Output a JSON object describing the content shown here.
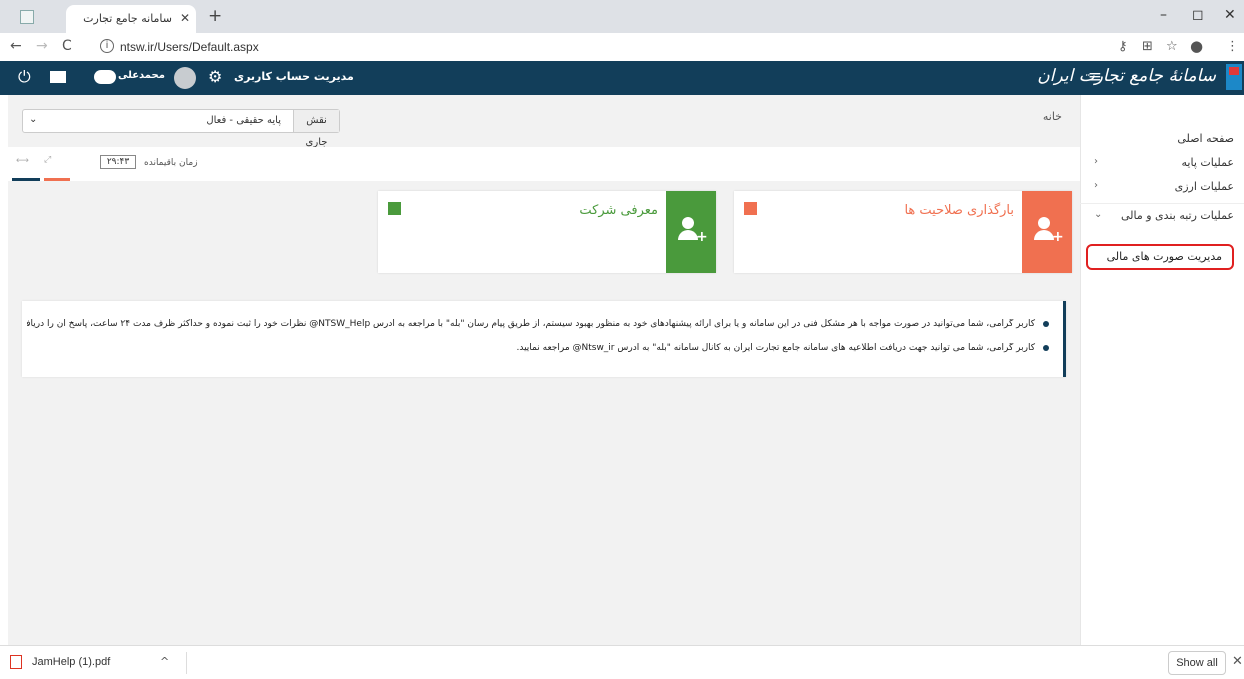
{
  "browser": {
    "tab_title": "سامانه جامع تجارت",
    "tab_close": "✕",
    "new_tab": "+",
    "url": "ntsw.ir/Users/Default.aspx",
    "back": "←",
    "forward": "→",
    "reload": "C",
    "info": "i",
    "minimize": "–",
    "maximize": "◻",
    "close": "✕",
    "key_icon": "⚷",
    "translate_icon": "⊞",
    "star_icon": "☆",
    "profile_icon": "●",
    "menu_icon": "⋮"
  },
  "header": {
    "brand": "سامانهٔ جامع تجارت ایران",
    "hamburger": "≡",
    "account_settings": "مدیریت حساب کاربری",
    "gear": "⚙",
    "username": "محمدعلی",
    "power": "⏻",
    "colors": {
      "bar": "#123e5a"
    }
  },
  "sidebar": {
    "items": [
      {
        "label": "صفحه اصلی",
        "icon": "🏠",
        "arrow": ""
      },
      {
        "label": "عملیات پایه",
        "icon": "📊",
        "arrow": "‹"
      },
      {
        "label": "عملیات ارزی",
        "icon": "👥",
        "arrow": "‹"
      },
      {
        "label": "عملیات رتبه بندی و مالی",
        "icon": "📊",
        "arrow": "⌄"
      }
    ],
    "submenu_item": "مدیریت صورت های مالی"
  },
  "main": {
    "breadcrumb": "خانه",
    "home_icon": "🏠",
    "role_label": "نقش جاری",
    "role_value": "پایه حقیقی - فعال",
    "role_caret": "⌄",
    "time_label": "زمان باقیمانده",
    "time_value": "۲۹:۴۳",
    "arrows_icon": "⟷",
    "expand_icon": "⤢",
    "cards": [
      {
        "title": "بارگذاری صلاحیت ها",
        "color": "#f07050",
        "icon": "user-plus"
      },
      {
        "title": "معرفی شرکت",
        "color": "#4a9a3c",
        "icon": "user-plus"
      }
    ],
    "notices": [
      "کاربر گرامی، شما می‌توانید در صورت مواجه با هر مشکل فنی در این سامانه و یا برای ارائه پیشنهادهای خود به منظور بهبود سیستم، از طریق پیام رسان \"بله\" با مراجعه به آدرس NTSW_Help@ نظرات خود را ثبت نموده و حداکثر ظرف مدت ۲۴ ساعت، پاسخ آن را دریافت نمایید",
      "کاربر گرامی، شما می توانید جهت دریافت اطلاعیه های سامانه جامع تجارت ایران به کانال سامانه \"بله\" به آدرس Ntsw_ir@ مراجعه نمایید."
    ]
  },
  "downloads": {
    "file_name": "JamHelp (1).pdf",
    "caret": "^",
    "show_all": "Show all",
    "close": "✕"
  }
}
